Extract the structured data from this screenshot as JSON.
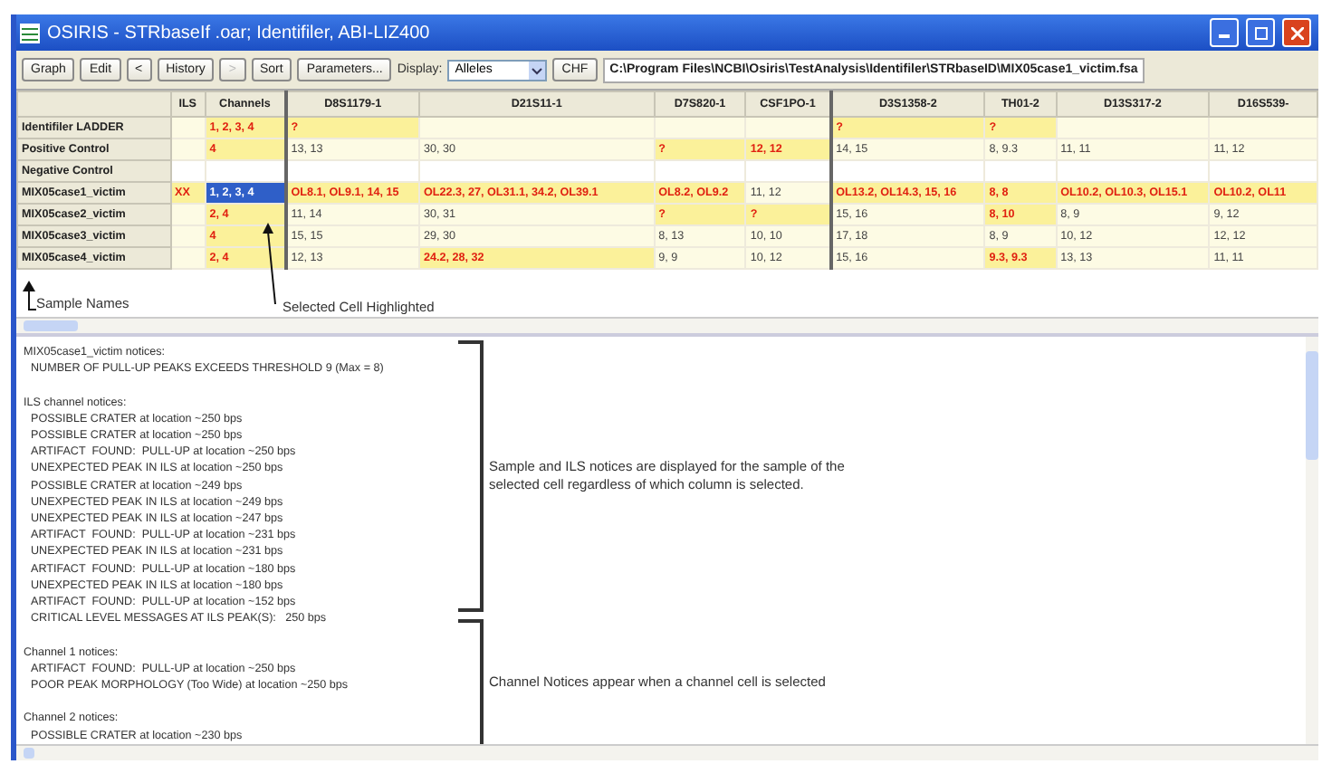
{
  "window": {
    "title": "OSIRIS - STRbaseIf .oar; Identifiler, ABI-LIZ400"
  },
  "toolbar": {
    "buttons": [
      {
        "label": "Graph",
        "disabled": false
      },
      {
        "label": "Edit",
        "disabled": false
      },
      {
        "label": "<",
        "disabled": false
      },
      {
        "label": "History",
        "disabled": false
      },
      {
        "label": ">",
        "disabled": true
      },
      {
        "label": "Sort",
        "disabled": false
      },
      {
        "label": "Parameters...",
        "disabled": false
      }
    ],
    "display_label": "Display:",
    "display_value": "Alleles",
    "chf_button": "CHF",
    "file_path": "C:\\Program Files\\NCBI\\Osiris\\TestAnalysis\\Identifiler\\STRbaseID\\MIX05case1_victim.fsa"
  },
  "table": {
    "columns": [
      "ILS",
      "Channels",
      "D8S1179-1",
      "D21S11-1",
      "D7S820-1",
      "CSF1PO-1",
      "D3S1358-2",
      "TH01-2",
      "D13S317-2",
      "D16S539-"
    ],
    "rows": [
      {
        "name": "Identifiler LADDER",
        "tinted": true,
        "cells": [
          {
            "text": "",
            "alert": false,
            "selected": false
          },
          {
            "text": "1, 2, 3, 4",
            "alert": true,
            "selected": false
          },
          {
            "text": "?",
            "alert": true,
            "selected": false
          },
          {
            "text": "",
            "alert": false,
            "selected": false
          },
          {
            "text": "",
            "alert": false,
            "selected": false
          },
          {
            "text": "",
            "alert": false,
            "selected": false
          },
          {
            "text": "?",
            "alert": true,
            "selected": false
          },
          {
            "text": "?",
            "alert": true,
            "selected": false
          },
          {
            "text": "",
            "alert": false,
            "selected": false
          },
          {
            "text": "",
            "alert": false,
            "selected": false
          }
        ]
      },
      {
        "name": "Positive Control",
        "tinted": true,
        "cells": [
          {
            "text": "",
            "alert": false,
            "selected": false
          },
          {
            "text": "4",
            "alert": true,
            "selected": false
          },
          {
            "text": "13, 13",
            "alert": false,
            "selected": false
          },
          {
            "text": "30, 30",
            "alert": false,
            "selected": false
          },
          {
            "text": "?",
            "alert": true,
            "selected": false
          },
          {
            "text": "12, 12",
            "alert": true,
            "selected": false
          },
          {
            "text": "14, 15",
            "alert": false,
            "selected": false
          },
          {
            "text": "8, 9.3",
            "alert": false,
            "selected": false
          },
          {
            "text": "11, 11",
            "alert": false,
            "selected": false
          },
          {
            "text": "11, 12",
            "alert": false,
            "selected": false
          }
        ]
      },
      {
        "name": "Negative Control",
        "tinted": false,
        "cells": [
          {
            "text": "",
            "alert": false,
            "selected": false
          },
          {
            "text": "",
            "alert": false,
            "selected": false
          },
          {
            "text": "",
            "alert": false,
            "selected": false
          },
          {
            "text": "",
            "alert": false,
            "selected": false
          },
          {
            "text": "",
            "alert": false,
            "selected": false
          },
          {
            "text": "",
            "alert": false,
            "selected": false
          },
          {
            "text": "",
            "alert": false,
            "selected": false
          },
          {
            "text": "",
            "alert": false,
            "selected": false
          },
          {
            "text": "",
            "alert": false,
            "selected": false
          },
          {
            "text": "",
            "alert": false,
            "selected": false
          }
        ]
      },
      {
        "name": "MIX05case1_victim",
        "tinted": true,
        "cells": [
          {
            "text": "XX",
            "alert": true,
            "selected": false
          },
          {
            "text": "1, 2, 3, 4",
            "alert": true,
            "selected": true
          },
          {
            "text": "OL8.1, OL9.1, 14, 15",
            "alert": true,
            "selected": false
          },
          {
            "text": "OL22.3, 27, OL31.1, 34.2, OL39.1",
            "alert": true,
            "selected": false
          },
          {
            "text": "OL8.2, OL9.2",
            "alert": true,
            "selected": false
          },
          {
            "text": "11, 12",
            "alert": false,
            "selected": false
          },
          {
            "text": "OL13.2, OL14.3, 15, 16",
            "alert": true,
            "selected": false
          },
          {
            "text": "8, 8",
            "alert": true,
            "selected": false
          },
          {
            "text": "OL10.2, OL10.3, OL15.1",
            "alert": true,
            "selected": false
          },
          {
            "text": "OL10.2, OL11",
            "alert": true,
            "selected": false
          }
        ]
      },
      {
        "name": "MIX05case2_victim",
        "tinted": true,
        "cells": [
          {
            "text": "",
            "alert": false,
            "selected": false
          },
          {
            "text": "2, 4",
            "alert": true,
            "selected": false
          },
          {
            "text": "11, 14",
            "alert": false,
            "selected": false
          },
          {
            "text": "30, 31",
            "alert": false,
            "selected": false
          },
          {
            "text": "?",
            "alert": true,
            "selected": false
          },
          {
            "text": "?",
            "alert": true,
            "selected": false
          },
          {
            "text": "15, 16",
            "alert": false,
            "selected": false
          },
          {
            "text": "8, 10",
            "alert": true,
            "selected": false
          },
          {
            "text": "8, 9",
            "alert": false,
            "selected": false
          },
          {
            "text": "9, 12",
            "alert": false,
            "selected": false
          }
        ]
      },
      {
        "name": "MIX05case3_victim",
        "tinted": true,
        "cells": [
          {
            "text": "",
            "alert": false,
            "selected": false
          },
          {
            "text": "4",
            "alert": true,
            "selected": false
          },
          {
            "text": "15, 15",
            "alert": false,
            "selected": false
          },
          {
            "text": "29, 30",
            "alert": false,
            "selected": false
          },
          {
            "text": "8, 13",
            "alert": false,
            "selected": false
          },
          {
            "text": "10, 10",
            "alert": false,
            "selected": false
          },
          {
            "text": "17, 18",
            "alert": false,
            "selected": false
          },
          {
            "text": "8, 9",
            "alert": false,
            "selected": false
          },
          {
            "text": "10, 12",
            "alert": false,
            "selected": false
          },
          {
            "text": "12, 12",
            "alert": false,
            "selected": false
          }
        ]
      },
      {
        "name": "MIX05case4_victim",
        "tinted": true,
        "cells": [
          {
            "text": "",
            "alert": false,
            "selected": false
          },
          {
            "text": "2, 4",
            "alert": true,
            "selected": false
          },
          {
            "text": "12, 13",
            "alert": false,
            "selected": false
          },
          {
            "text": "24.2, 28, 32",
            "alert": true,
            "selected": false
          },
          {
            "text": "9, 9",
            "alert": false,
            "selected": false
          },
          {
            "text": "10, 12",
            "alert": false,
            "selected": false
          },
          {
            "text": "15, 16",
            "alert": false,
            "selected": false
          },
          {
            "text": "9.3, 9.3",
            "alert": true,
            "selected": false
          },
          {
            "text": "13, 13",
            "alert": false,
            "selected": false
          },
          {
            "text": "11, 11",
            "alert": false,
            "selected": false
          }
        ]
      }
    ]
  },
  "grid_annotations": {
    "sample_names": "Sample Names",
    "selected_cell": "Selected Cell Highlighted"
  },
  "notices": [
    {
      "heading": "MIX05case1_victim notices:",
      "items": [
        "NUMBER OF PULL-UP PEAKS EXCEEDS THRESHOLD 9 (Max = 8)"
      ]
    },
    {
      "heading": "ILS channel notices:",
      "items": [
        "POSSIBLE CRATER at location ~250 bps",
        "POSSIBLE CRATER at location ~250 bps",
        "ARTIFACT  FOUND:  PULL-UP at location ~250 bps",
        "UNEXPECTED PEAK IN ILS at location ~250 bps",
        "POSSIBLE CRATER at location ~249 bps",
        "UNEXPECTED PEAK IN ILS at location ~249 bps",
        "UNEXPECTED PEAK IN ILS at location ~247 bps",
        "ARTIFACT  FOUND:  PULL-UP at location ~231 bps",
        "UNEXPECTED PEAK IN ILS at location ~231 bps",
        "ARTIFACT  FOUND:  PULL-UP at location ~180 bps",
        "UNEXPECTED PEAK IN ILS at location ~180 bps",
        "ARTIFACT  FOUND:  PULL-UP at location ~152 bps",
        "CRITICAL LEVEL MESSAGES AT ILS PEAK(S):   250 bps"
      ]
    },
    {
      "heading": "Channel 1 notices:",
      "items": [
        "ARTIFACT  FOUND:  PULL-UP at location ~250 bps",
        "POOR PEAK MORPHOLOGY (Too Wide) at location ~250 bps"
      ]
    },
    {
      "heading": "Channel 2 notices:",
      "items": [
        "POSSIBLE CRATER at location ~230 bps"
      ]
    }
  ],
  "notice_annotations": [
    "Sample and ILS notices are displayed for the sample of the selected cell regardless of which column is selected.",
    "Channel Notices  appear when a channel cell is selected"
  ]
}
